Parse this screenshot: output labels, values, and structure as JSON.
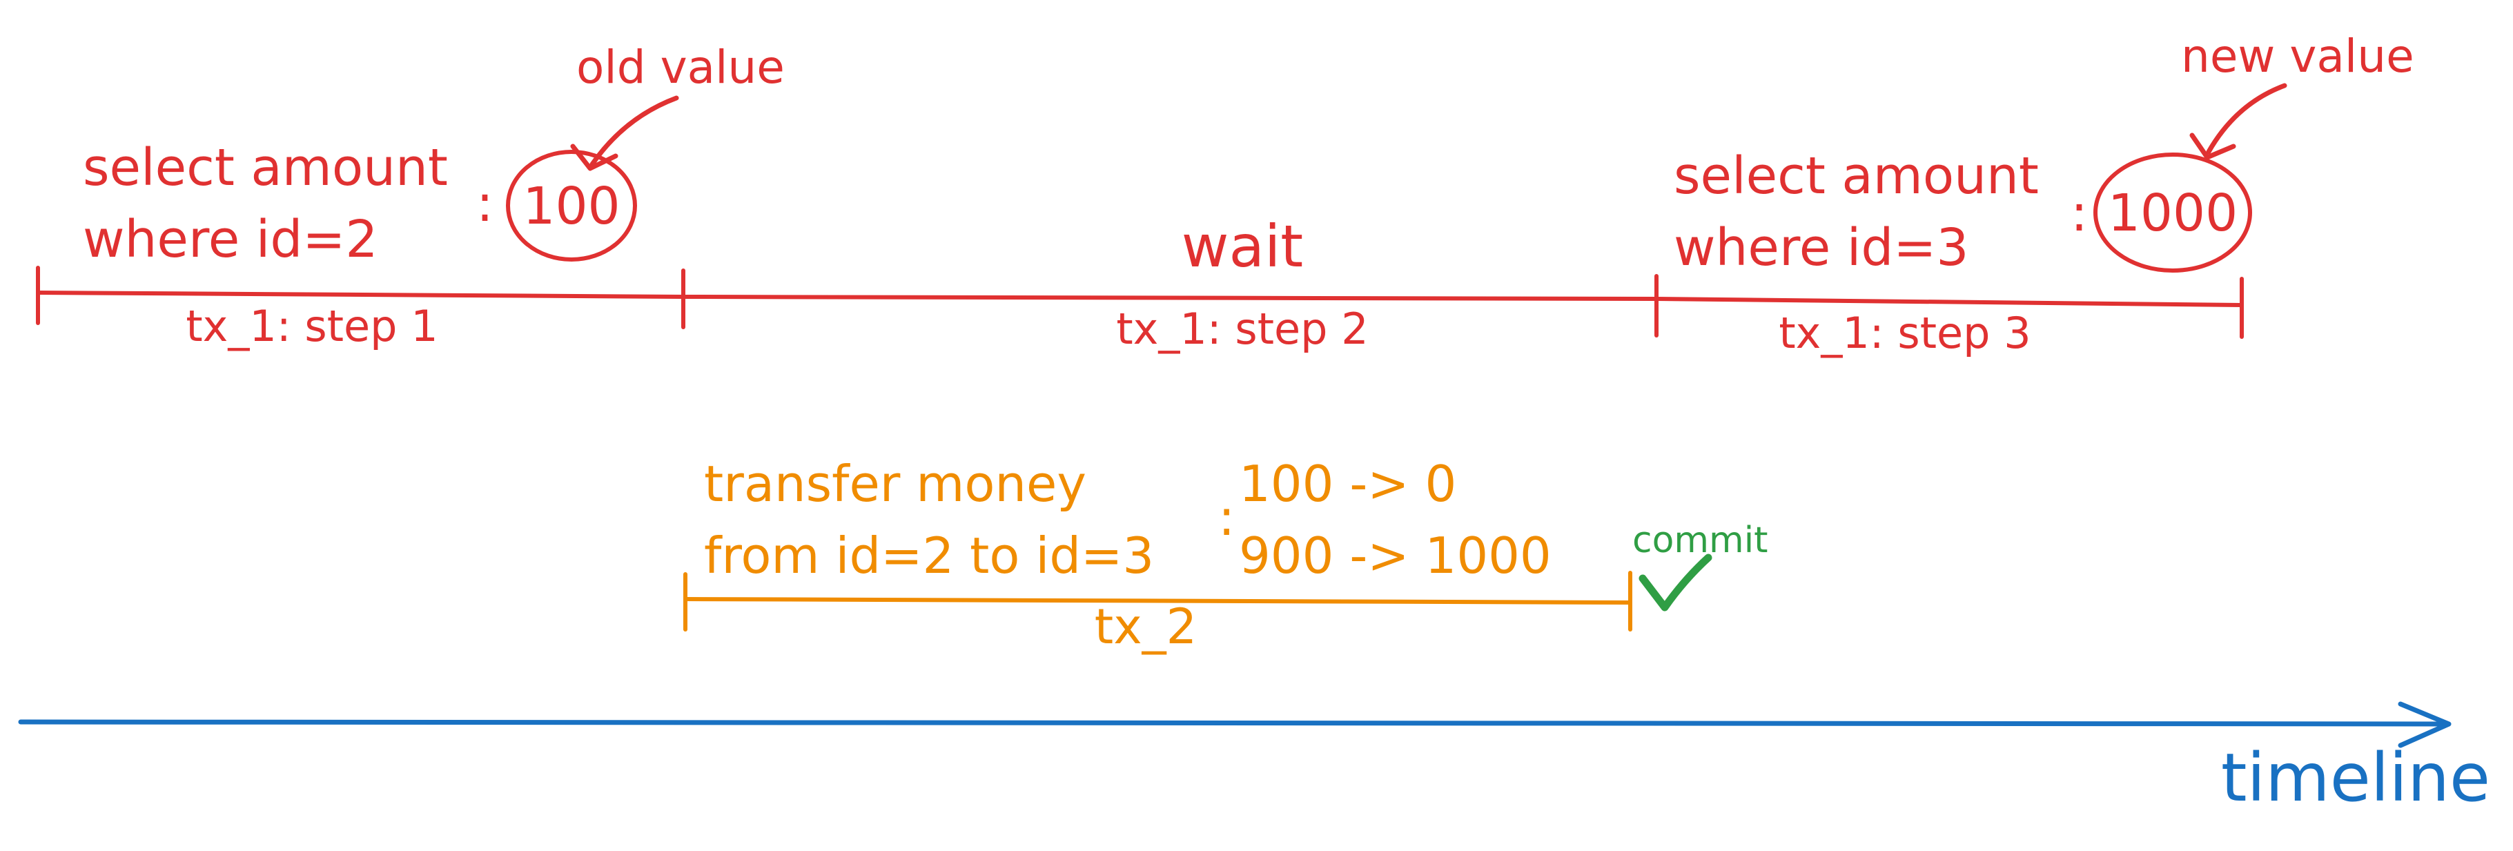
{
  "colors": {
    "tx1": "#e03131",
    "tx2": "#f08c00",
    "commit": "#2f9e44",
    "timeline": "#1971c2"
  },
  "tx1": {
    "step1": {
      "query_line1": "select amount",
      "query_line2": "where id=2",
      "colon": ":",
      "value": "100",
      "note": "old value",
      "label": "tx_1: step 1"
    },
    "step2": {
      "action": "wait",
      "label": "tx_1: step 2"
    },
    "step3": {
      "query_line1": "select amount",
      "query_line2": "where id=3",
      "colon": ":",
      "value": "1000",
      "note": "new value",
      "label": "tx_1: step 3"
    }
  },
  "tx2": {
    "action_line1": "transfer money",
    "action_line2": "from id=2 to id=3",
    "colon": ":",
    "change_line1": "100 -> 0",
    "change_line2": "900 -> 1000",
    "label": "tx_2",
    "commit_label": "commit",
    "commit_icon": "checkmark-icon"
  },
  "timeline": {
    "label": "timeline"
  }
}
